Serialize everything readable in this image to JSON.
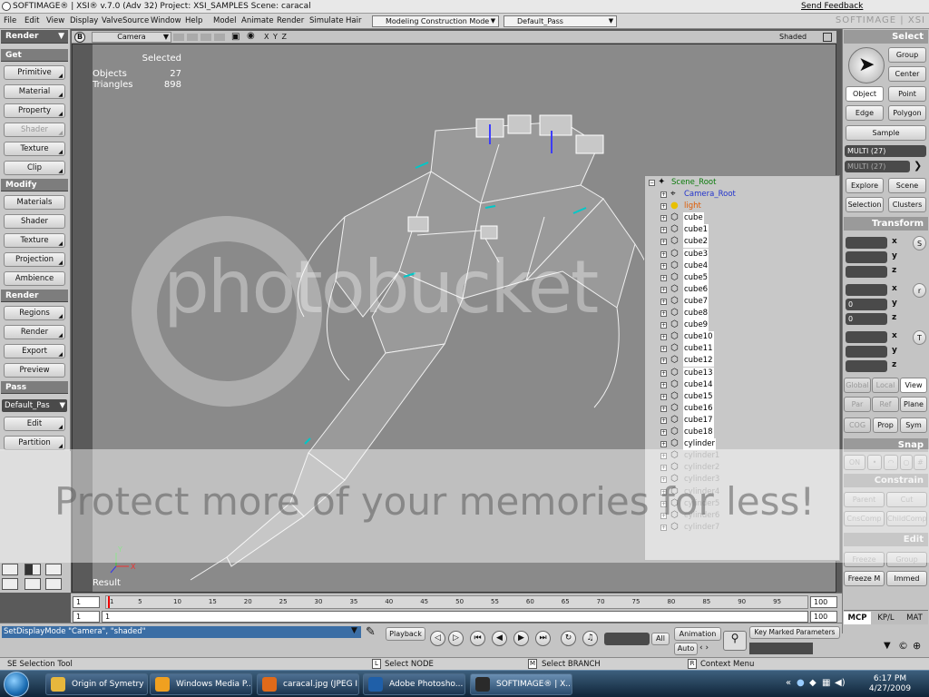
{
  "window": {
    "title": "SOFTIMAGE® | XSI® v.7.0 (Adv 32) Project: XSI_SAMPLES    Scene: caracal",
    "feedback_link": "Send Feedback",
    "brand": "SOFTIMAGE | XSI"
  },
  "menubar": {
    "items": [
      "File",
      "Edit",
      "View",
      "Display",
      "ValveSource",
      "Window",
      "Help",
      "Model",
      "Animate",
      "Render",
      "Simulate",
      "Hair"
    ],
    "mode_combo": "Modeling Construction Mode",
    "pass_combo": "Default_Pass"
  },
  "left_panel": {
    "header": "Render",
    "sections": [
      {
        "title": "Get",
        "buttons": [
          {
            "label": "Primitive",
            "enabled": true
          },
          {
            "label": "Material",
            "enabled": true
          },
          {
            "label": "Property",
            "enabled": true
          },
          {
            "label": "Shader",
            "enabled": false
          },
          {
            "label": "Texture",
            "enabled": true
          },
          {
            "label": "Clip",
            "enabled": true
          }
        ]
      },
      {
        "title": "Modify",
        "buttons": [
          {
            "label": "Materials",
            "enabled": true
          },
          {
            "label": "Shader",
            "enabled": true
          },
          {
            "label": "Texture",
            "enabled": true
          },
          {
            "label": "Projection",
            "enabled": true
          },
          {
            "label": "Ambience",
            "enabled": true
          }
        ]
      },
      {
        "title": "Render",
        "buttons": [
          {
            "label": "Regions",
            "enabled": true
          },
          {
            "label": "Render",
            "enabled": true
          },
          {
            "label": "Export",
            "enabled": true
          },
          {
            "label": "Preview",
            "enabled": true
          }
        ]
      },
      {
        "title": "Pass",
        "buttons": [
          {
            "label": "Edit",
            "enabled": true
          },
          {
            "label": "Partition",
            "enabled": true
          }
        ]
      }
    ],
    "pass_value": "Default_Pas"
  },
  "viewport": {
    "letter": "B",
    "camera_label": "Camera",
    "axes_label": "X Y Z",
    "shading": "Shaded",
    "hud": {
      "selected_label": "Selected",
      "objects_label": "Objects",
      "objects_value": "27",
      "triangles_label": "Triangles",
      "triangles_value": "898"
    },
    "result_label": "Result"
  },
  "explorer": {
    "root": "Scene_Root",
    "items": [
      {
        "name": "Camera_Root",
        "style": "blue"
      },
      {
        "name": "light",
        "style": "orange"
      },
      {
        "name": "cube",
        "style": "sel"
      },
      {
        "name": "cube1",
        "style": "sel"
      },
      {
        "name": "cube2",
        "style": "sel"
      },
      {
        "name": "cube3",
        "style": "sel"
      },
      {
        "name": "cube4",
        "style": "sel"
      },
      {
        "name": "cube5",
        "style": "sel"
      },
      {
        "name": "cube6",
        "style": "sel"
      },
      {
        "name": "cube7",
        "style": "sel"
      },
      {
        "name": "cube8",
        "style": "sel"
      },
      {
        "name": "cube9",
        "style": "sel"
      },
      {
        "name": "cube10",
        "style": "sel"
      },
      {
        "name": "cube11",
        "style": "sel"
      },
      {
        "name": "cube12",
        "style": "sel"
      },
      {
        "name": "cube13",
        "style": "sel"
      },
      {
        "name": "cube14",
        "style": "sel"
      },
      {
        "name": "cube15",
        "style": "sel"
      },
      {
        "name": "cube16",
        "style": "sel"
      },
      {
        "name": "cube17",
        "style": "sel"
      },
      {
        "name": "cube18",
        "style": "sel"
      },
      {
        "name": "cylinder",
        "style": "sel"
      },
      {
        "name": "cylinder1",
        "style": "hid"
      },
      {
        "name": "cylinder2",
        "style": "hid"
      },
      {
        "name": "cylinder3",
        "style": "hid"
      },
      {
        "name": "cylinder4",
        "style": "hid"
      },
      {
        "name": "cylinder5",
        "style": "hid"
      },
      {
        "name": "cylinder6",
        "style": "hid"
      },
      {
        "name": "cylinder7",
        "style": "hid"
      }
    ]
  },
  "right_panel": {
    "select_header": "Select",
    "group": "Group",
    "center": "Center",
    "object": "Object",
    "point": "Point",
    "edge": "Edge",
    "polygon": "Polygon",
    "sample": "Sample",
    "multi1": "MULTI (27)",
    "multi2": "MULTI (27)",
    "explore": "Explore",
    "scene": "Scene",
    "selection": "Selection",
    "clusters": "Clusters",
    "transform_header": "Transform",
    "s_label": "S",
    "r_label": "r",
    "t_label": "T",
    "r_y_value": "0",
    "r_z_value": "0",
    "global": "Global",
    "local": "Local",
    "view": "View",
    "par": "Par",
    "ref": "Ref",
    "plane": "Plane",
    "cog": "COG",
    "prop": "Prop",
    "sym": "Sym",
    "snap_header": "Snap",
    "on": "ON",
    "constrain_header": "Constrain",
    "parent": "Parent",
    "cut": "Cut",
    "cnscomp": "CnsComp",
    "childcomp": "ChildComp",
    "edit_header": "Edit",
    "freeze": "Freeze",
    "group2": "Group",
    "freeze_m": "Freeze M",
    "immed": "Immed",
    "tabs": [
      "MCP",
      "KP/L",
      "MAT"
    ]
  },
  "timeline": {
    "start_value": "1",
    "end_value": "100",
    "lower_start": "1",
    "lower_current": "1",
    "lower_end": "100",
    "ticks": [
      "1",
      "5",
      "10",
      "15",
      "20",
      "25",
      "30",
      "35",
      "40",
      "45",
      "50",
      "55",
      "60",
      "65",
      "70",
      "75",
      "80",
      "85",
      "90",
      "95"
    ]
  },
  "commandbar": {
    "command": "SetDisplayMode \"Camera\", \"shaded\"",
    "playback": "Playback",
    "all": "All",
    "animation": "Animation",
    "auto": "Auto",
    "key_marked": "Key Marked Parameters"
  },
  "statusbar": {
    "tool": "SE Selection Tool",
    "l_hint": "Select NODE",
    "m_hint": "Select BRANCH",
    "r_hint": "Context Menu"
  },
  "taskbar": {
    "tasks": [
      {
        "label": "Origin of Symetry",
        "color": "#e7b73d"
      },
      {
        "label": "Windows Media P...",
        "color": "#f0a020"
      },
      {
        "label": "caracal.jpg (JPEG I...",
        "color": "#e06a1a"
      },
      {
        "label": "Adobe Photosho...",
        "color": "#1f5fa8"
      },
      {
        "label": "SOFTIMAGE® | X...",
        "color": "#2a2a2a"
      }
    ],
    "time": "6:17 PM",
    "date": "4/27/2009"
  },
  "watermark": {
    "logo_text": "photobucket",
    "band_text": "Protect more of your memories for less!"
  }
}
